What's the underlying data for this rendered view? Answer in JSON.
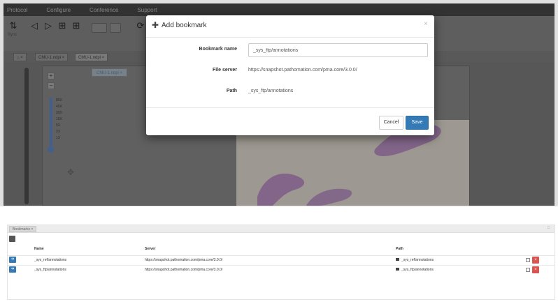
{
  "menu": [
    "Protocol",
    "Configure",
    "Conference",
    "Support"
  ],
  "toolbar": {
    "sync_label": "Sync"
  },
  "tabs": [
    "CMU-1.ndpi",
    "CMU-1.ndpi"
  ],
  "viewer": {
    "tab_label": "CMU-1.ndpi",
    "zoom_levels": [
      "80X",
      "40X",
      "20X",
      "10X",
      "5X",
      "2X",
      "1X"
    ]
  },
  "dialog": {
    "title": "Add bookmark",
    "fields": [
      {
        "label": "Bookmark name",
        "value": "_sys_ftp/annotations"
      },
      {
        "label": "File server",
        "value": "https://snapshot.pathomation.com/pma.core/3.0.0/"
      },
      {
        "label": "Path",
        "value": "_sys_ftp/annotations"
      }
    ],
    "cancel_label": "Cancel",
    "save_label": "Save"
  },
  "bookmarks_panel": {
    "tab_label": "Bookmarks",
    "columns": [
      "Name",
      "Server",
      "Path"
    ],
    "rows": [
      {
        "name": "_sys_ref/annotations",
        "server": "https://snapshot.pathomation.com/pma.core/3.0.0/",
        "path": "_sys_ref/annotations"
      },
      {
        "name": "_sys_ftp/annotations",
        "server": "https://snapshot.pathomation.com/pma.core/3.0.0/",
        "path": "_sys_ftp/annotations"
      }
    ]
  },
  "colors": {
    "primary": "#337ab7",
    "danger": "#d9534f",
    "tissue": "#8f6a9a"
  }
}
